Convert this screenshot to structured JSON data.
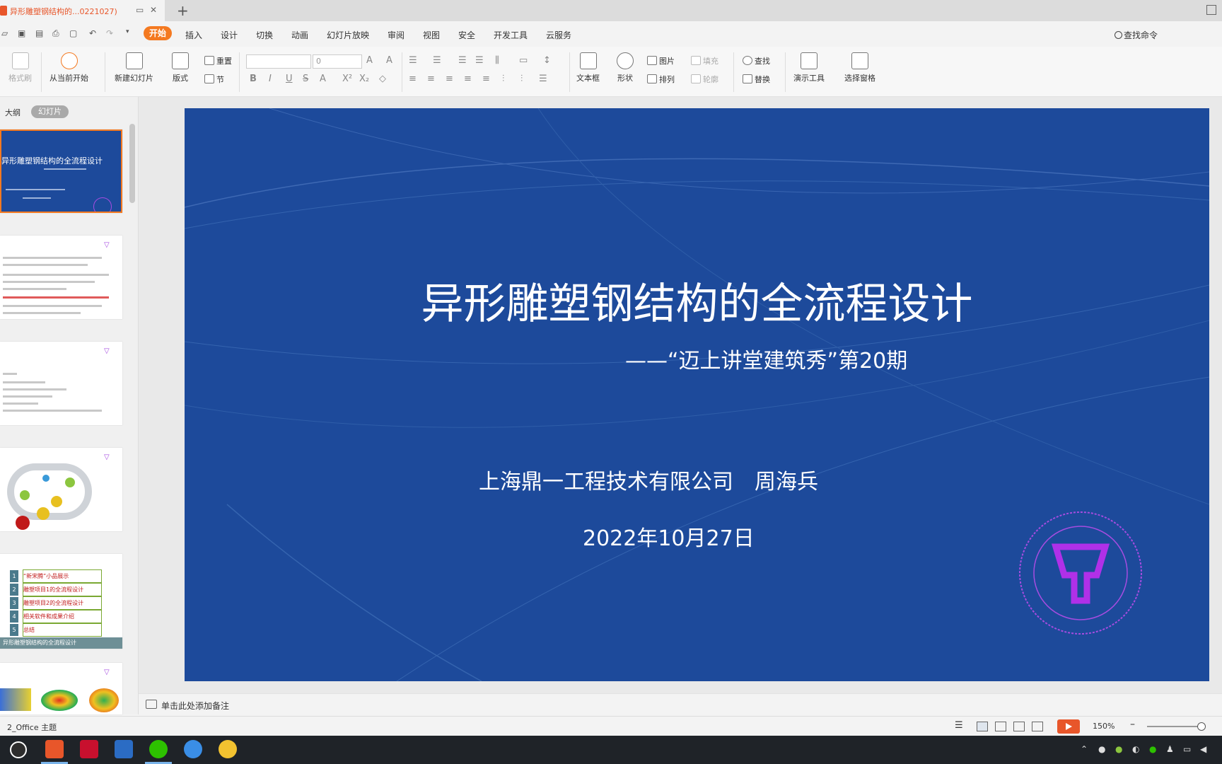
{
  "window": {
    "tab_title": "异形雕塑钢结构的...0221027)",
    "new_tab": "+",
    "close": "✕"
  },
  "menu": {
    "items": [
      "开始",
      "插入",
      "设计",
      "切换",
      "动画",
      "幻灯片放映",
      "审阅",
      "视图",
      "安全",
      "开发工具",
      "云服务"
    ],
    "active": "开始",
    "search": "查找命令"
  },
  "ribbon": {
    "format_painter": "格式刷",
    "start_from_current": "从当前开始",
    "new_slide": "新建幻灯片",
    "layout": "版式",
    "reset": "重置",
    "section": "节",
    "font_size": "0",
    "text_box": "文本框",
    "shape": "形状",
    "picture": "图片",
    "arrange": "排列",
    "fill": "填充",
    "outline": "轮廓",
    "find": "查找",
    "replace": "替换",
    "present_tools": "演示工具",
    "selection_pane": "选择窗格"
  },
  "left_panel": {
    "tab_outline": "大纲",
    "tab_slides": "幻灯片",
    "thumb1_title": "异形雕塑钢结构的全流程设计",
    "thumb5_items": [
      "“新宋腾”小品展示",
      "雕塑项目1的全流程设计",
      "雕塑项目2的全流程设计",
      "相关软件和成果介绍",
      "总结"
    ],
    "thumb5_footer": "异形雕塑钢结构的全流程设计"
  },
  "slide": {
    "title": "异形雕塑钢结构的全流程设计",
    "subtitle": "——“迈上讲堂建筑秀”第20期",
    "company": "上海鼎一工程技术有限公司　周海兵",
    "date": "2022年10月27日",
    "seal_text": "上海鼎一工程技术有限公司"
  },
  "notes": {
    "placeholder": "单击此处添加备注"
  },
  "status": {
    "theme": "2_Office 主题",
    "zoom": "150%"
  },
  "colors": {
    "accent": "#f47920",
    "slide_bg": "#1d4a9b",
    "seal": "#a64ce0"
  }
}
